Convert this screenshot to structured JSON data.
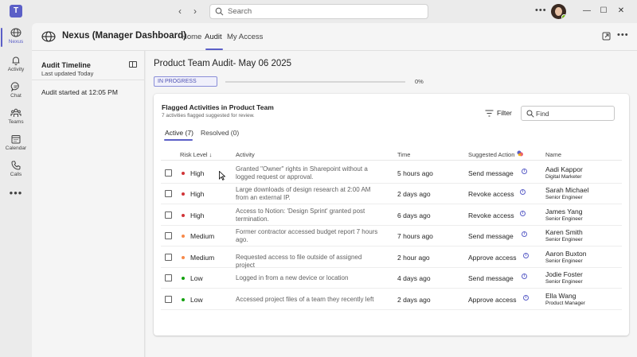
{
  "titlebar": {
    "search_placeholder": "Search",
    "more_label": "•••"
  },
  "rail": {
    "items": [
      {
        "label": "Nexus",
        "icon": "globe-icon",
        "active": true
      },
      {
        "label": "Activity",
        "icon": "bell-icon"
      },
      {
        "label": "Chat",
        "icon": "chat-icon"
      },
      {
        "label": "Teams",
        "icon": "teams-icon"
      },
      {
        "label": "Calendar",
        "icon": "calendar-icon"
      },
      {
        "label": "Calls",
        "icon": "phone-icon"
      }
    ],
    "more_label": "•••"
  },
  "app": {
    "title": "Nexus (Manager Dashboard)",
    "tabs": [
      {
        "label": "Home"
      },
      {
        "label": "Audit",
        "active": true
      },
      {
        "label": "My Access"
      }
    ]
  },
  "left_panel": {
    "title": "Audit Timeline",
    "subtitle": "Last updated Today",
    "item": "Audit started at 12:05 PM"
  },
  "main": {
    "title": "Product Team Audit- May 06 2025",
    "status": "IN PROGRESS",
    "progress_percent": 0,
    "progress_text": "0%"
  },
  "card": {
    "title": "Flagged Activities in Product Team",
    "subtitle": "7 activities flagged suggested for review.",
    "filter_label": "Filter",
    "find_placeholder": "Find",
    "tabs": {
      "active": "Active (7)",
      "resolved": "Resolved (0)"
    },
    "columns": {
      "risk": "Risk Level ↓",
      "activity": "Activity",
      "time": "Time",
      "suggested": "Suggested Action",
      "name": "Name"
    },
    "rows": [
      {
        "risk": "High",
        "risk_color": "#d13438",
        "activity": "Granted \"Owner\" rights in Sharepoint without a logged request or approval.",
        "time": "5 hours ago",
        "action": "Send message",
        "name": "Aadi Kappor",
        "role": "Digital Marketer"
      },
      {
        "risk": "High",
        "risk_color": "#d13438",
        "activity": "Large downloads of design research at 2:00 AM from an external IP.",
        "time": "2 days ago",
        "action": "Revoke access",
        "name": "Sarah Michael",
        "role": "Senior Engineer"
      },
      {
        "risk": "High",
        "risk_color": "#d13438",
        "activity": "Access to Notion: 'Design Sprint' granted post termination.",
        "time": "6 days ago",
        "action": "Revoke access",
        "name": "James Yang",
        "role": "Senior Engineer"
      },
      {
        "risk": "Medium",
        "risk_color": "#f7894a",
        "activity": "Former contractor accessed budget report 7 hours ago.",
        "time": "7 hours ago",
        "action": "Send message",
        "name": "Karen Smith",
        "role": "Senior Engineer"
      },
      {
        "risk": "Medium",
        "risk_color": "#f7894a",
        "activity": "Requested access to file outside of assigned project",
        "time": "2 hour ago",
        "action": "Approve access",
        "name": "Aaron Buxton",
        "role": "Senior Engineer"
      },
      {
        "risk": "Low",
        "risk_color": "#13a10e",
        "activity": "Logged in from a new device or location",
        "time": "4 days ago",
        "action": "Send message",
        "name": "Jodie Foster",
        "role": "Senior Engineer"
      },
      {
        "risk": "Low",
        "risk_color": "#13a10e",
        "activity": "Accessed project files of a team they recently left",
        "time": "2 days ago",
        "action": "Approve access",
        "name": "Ella Wang",
        "role": "Product Manager"
      }
    ]
  }
}
